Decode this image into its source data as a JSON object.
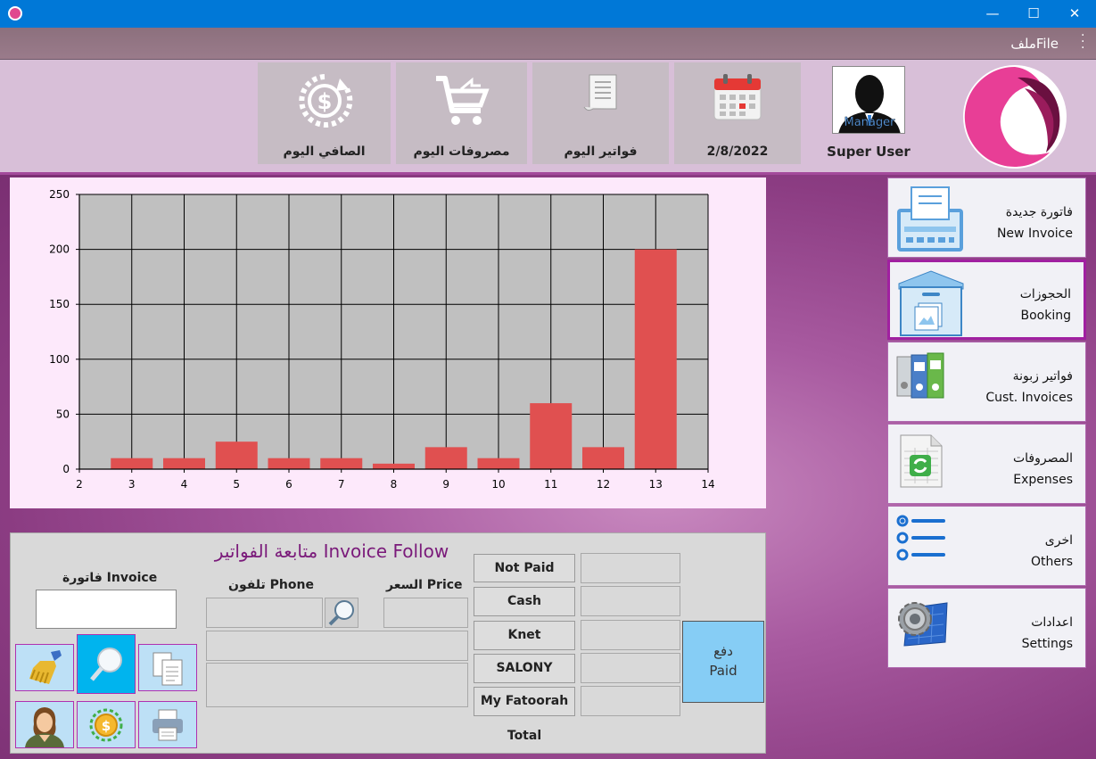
{
  "window": {
    "minimize": "—",
    "maximize": "☐",
    "close": "✕"
  },
  "menu": {
    "file": "ملفFile"
  },
  "header": {
    "tiles": [
      {
        "label": "الصافي اليوم",
        "icon": "dollar-refresh-icon"
      },
      {
        "label": "مصروفات اليوم",
        "icon": "cart-icon"
      },
      {
        "label": "فواتير اليوم",
        "icon": "receipt-icon"
      },
      {
        "label": "2/8/2022",
        "icon": "calendar-icon"
      }
    ],
    "user": {
      "name": "Super User",
      "badge": "Manager"
    }
  },
  "chart_data": {
    "type": "bar",
    "x": [
      3,
      4,
      5,
      6,
      7,
      8,
      9,
      10,
      11,
      12,
      13
    ],
    "values": [
      10,
      10,
      25,
      10,
      10,
      5,
      20,
      10,
      60,
      20,
      200
    ],
    "xlim": [
      2,
      14
    ],
    "ylim": [
      0,
      250
    ],
    "xticks": [
      2,
      3,
      4,
      5,
      6,
      7,
      8,
      9,
      10,
      11,
      12,
      13,
      14
    ],
    "yticks": [
      0,
      50,
      100,
      150,
      200,
      250
    ],
    "grid": true,
    "bar_color": "#e05050",
    "plot_bg": "#c0c0c0"
  },
  "invoice_panel": {
    "title": "متابعة الفواتير Invoice Follow",
    "invoice_label": "فاتورة Invoice",
    "phone_label": "تلفون Phone",
    "price_label": "السعر Price",
    "payment_methods": [
      "Not Paid",
      "Cash",
      "Knet",
      "SALONY",
      "My Fatoorah"
    ],
    "total_label": "Total",
    "paid_ar": "دفع",
    "paid_en": "Paid"
  },
  "nav": [
    {
      "ar": "فاتورة جديدة",
      "en": "New Invoice",
      "icon": "invoice-printer-icon"
    },
    {
      "ar": "الحجوزات",
      "en": "Booking",
      "icon": "booking-box-icon"
    },
    {
      "ar": "فواتير زبونة",
      "en": "Cust. Invoices",
      "icon": "binders-icon"
    },
    {
      "ar": "المصروفات",
      "en": "Expenses",
      "icon": "spreadsheet-icon"
    },
    {
      "ar": "اخرى",
      "en": "Others",
      "icon": "list-radio-icon"
    },
    {
      "ar": "اعدادات",
      "en": "Settings",
      "icon": "settings-gear-icon"
    }
  ],
  "colors": {
    "accent": "#a020a0",
    "titlebar": "#0078d7",
    "paid": "#86cdf5"
  }
}
